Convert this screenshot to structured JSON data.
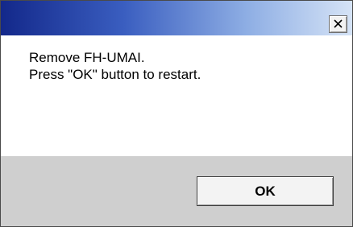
{
  "window": {
    "title": "",
    "close_icon": "close-icon"
  },
  "message": {
    "line1": "Remove FH-UMAI.",
    "line2": "Press \"OK\" button to restart."
  },
  "buttons": {
    "ok_label": "OK"
  },
  "colors": {
    "titlebar_start": "#13288a",
    "titlebar_end": "#d5e3f6",
    "footer_bg": "#cfcfcf",
    "content_bg": "#ffffff"
  }
}
